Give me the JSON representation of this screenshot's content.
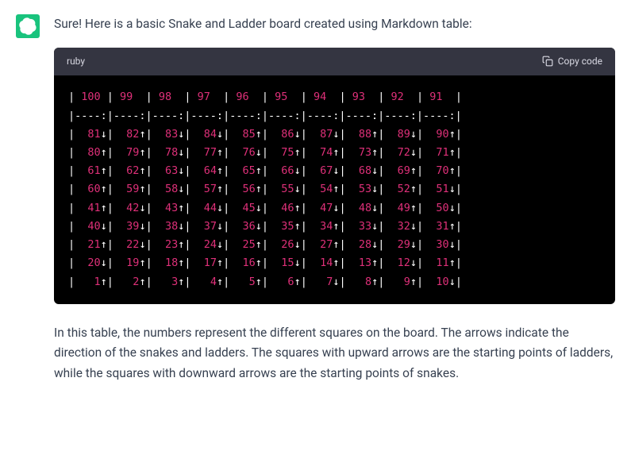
{
  "intro": "Sure! Here is a basic Snake and Ladder board created using Markdown table:",
  "code": {
    "language": "ruby",
    "copy_label": "Copy code",
    "rows": [
      [
        {
          "t": "| ",
          "c": "w"
        },
        {
          "t": "100",
          "c": "r"
        },
        {
          "t": " | ",
          "c": "w"
        },
        {
          "t": "99",
          "c": "r"
        },
        {
          "t": "  | ",
          "c": "w"
        },
        {
          "t": "98",
          "c": "r"
        },
        {
          "t": "  | ",
          "c": "w"
        },
        {
          "t": "97",
          "c": "r"
        },
        {
          "t": "  | ",
          "c": "w"
        },
        {
          "t": "96",
          "c": "r"
        },
        {
          "t": "  | ",
          "c": "w"
        },
        {
          "t": "95",
          "c": "r"
        },
        {
          "t": "  | ",
          "c": "w"
        },
        {
          "t": "94",
          "c": "r"
        },
        {
          "t": "  | ",
          "c": "w"
        },
        {
          "t": "93",
          "c": "r"
        },
        {
          "t": "  | ",
          "c": "w"
        },
        {
          "t": "92",
          "c": "r"
        },
        {
          "t": "  | ",
          "c": "w"
        },
        {
          "t": "91",
          "c": "r"
        },
        {
          "t": "  |",
          "c": "w"
        }
      ],
      [
        {
          "t": "|----:|----:|----:|----:|----:|----:|----:|----:|----:|----:|",
          "c": "w"
        }
      ],
      [
        {
          "t": "|  ",
          "c": "w"
        },
        {
          "t": "81",
          "c": "r"
        },
        {
          "t": "↓|  ",
          "c": "w"
        },
        {
          "t": "82",
          "c": "r"
        },
        {
          "t": "↑|  ",
          "c": "w"
        },
        {
          "t": "83",
          "c": "r"
        },
        {
          "t": "↓|  ",
          "c": "w"
        },
        {
          "t": "84",
          "c": "r"
        },
        {
          "t": "↓|  ",
          "c": "w"
        },
        {
          "t": "85",
          "c": "r"
        },
        {
          "t": "↑|  ",
          "c": "w"
        },
        {
          "t": "86",
          "c": "r"
        },
        {
          "t": "↓|  ",
          "c": "w"
        },
        {
          "t": "87",
          "c": "r"
        },
        {
          "t": "↓|  ",
          "c": "w"
        },
        {
          "t": "88",
          "c": "r"
        },
        {
          "t": "↑|  ",
          "c": "w"
        },
        {
          "t": "89",
          "c": "r"
        },
        {
          "t": "↓|  ",
          "c": "w"
        },
        {
          "t": "90",
          "c": "r"
        },
        {
          "t": "↑|",
          "c": "w"
        }
      ],
      [
        {
          "t": "|  ",
          "c": "w"
        },
        {
          "t": "80",
          "c": "r"
        },
        {
          "t": "↑|  ",
          "c": "w"
        },
        {
          "t": "79",
          "c": "r"
        },
        {
          "t": "↑|  ",
          "c": "w"
        },
        {
          "t": "78",
          "c": "r"
        },
        {
          "t": "↓|  ",
          "c": "w"
        },
        {
          "t": "77",
          "c": "r"
        },
        {
          "t": "↑|  ",
          "c": "w"
        },
        {
          "t": "76",
          "c": "r"
        },
        {
          "t": "↓|  ",
          "c": "w"
        },
        {
          "t": "75",
          "c": "r"
        },
        {
          "t": "↑|  ",
          "c": "w"
        },
        {
          "t": "74",
          "c": "r"
        },
        {
          "t": "↑|  ",
          "c": "w"
        },
        {
          "t": "73",
          "c": "r"
        },
        {
          "t": "↑|  ",
          "c": "w"
        },
        {
          "t": "72",
          "c": "r"
        },
        {
          "t": "↓|  ",
          "c": "w"
        },
        {
          "t": "71",
          "c": "r"
        },
        {
          "t": "↑|",
          "c": "w"
        }
      ],
      [
        {
          "t": "|  ",
          "c": "w"
        },
        {
          "t": "61",
          "c": "r"
        },
        {
          "t": "↑|  ",
          "c": "w"
        },
        {
          "t": "62",
          "c": "r"
        },
        {
          "t": "↑|  ",
          "c": "w"
        },
        {
          "t": "63",
          "c": "r"
        },
        {
          "t": "↓|  ",
          "c": "w"
        },
        {
          "t": "64",
          "c": "r"
        },
        {
          "t": "↑|  ",
          "c": "w"
        },
        {
          "t": "65",
          "c": "r"
        },
        {
          "t": "↑|  ",
          "c": "w"
        },
        {
          "t": "66",
          "c": "r"
        },
        {
          "t": "↓|  ",
          "c": "w"
        },
        {
          "t": "67",
          "c": "r"
        },
        {
          "t": "↓|  ",
          "c": "w"
        },
        {
          "t": "68",
          "c": "r"
        },
        {
          "t": "↓|  ",
          "c": "w"
        },
        {
          "t": "69",
          "c": "r"
        },
        {
          "t": "↑|  ",
          "c": "w"
        },
        {
          "t": "70",
          "c": "r"
        },
        {
          "t": "↑|",
          "c": "w"
        }
      ],
      [
        {
          "t": "|  ",
          "c": "w"
        },
        {
          "t": "60",
          "c": "r"
        },
        {
          "t": "↑|  ",
          "c": "w"
        },
        {
          "t": "59",
          "c": "r"
        },
        {
          "t": "↑|  ",
          "c": "w"
        },
        {
          "t": "58",
          "c": "r"
        },
        {
          "t": "↓|  ",
          "c": "w"
        },
        {
          "t": "57",
          "c": "r"
        },
        {
          "t": "↑|  ",
          "c": "w"
        },
        {
          "t": "56",
          "c": "r"
        },
        {
          "t": "↑|  ",
          "c": "w"
        },
        {
          "t": "55",
          "c": "r"
        },
        {
          "t": "↓|  ",
          "c": "w"
        },
        {
          "t": "54",
          "c": "r"
        },
        {
          "t": "↑|  ",
          "c": "w"
        },
        {
          "t": "53",
          "c": "r"
        },
        {
          "t": "↓|  ",
          "c": "w"
        },
        {
          "t": "52",
          "c": "r"
        },
        {
          "t": "↑|  ",
          "c": "w"
        },
        {
          "t": "51",
          "c": "r"
        },
        {
          "t": "↓|",
          "c": "w"
        }
      ],
      [
        {
          "t": "|  ",
          "c": "w"
        },
        {
          "t": "41",
          "c": "r"
        },
        {
          "t": "↑|  ",
          "c": "w"
        },
        {
          "t": "42",
          "c": "r"
        },
        {
          "t": "↓|  ",
          "c": "w"
        },
        {
          "t": "43",
          "c": "r"
        },
        {
          "t": "↑|  ",
          "c": "w"
        },
        {
          "t": "44",
          "c": "r"
        },
        {
          "t": "↓|  ",
          "c": "w"
        },
        {
          "t": "45",
          "c": "r"
        },
        {
          "t": "↓|  ",
          "c": "w"
        },
        {
          "t": "46",
          "c": "r"
        },
        {
          "t": "↑|  ",
          "c": "w"
        },
        {
          "t": "47",
          "c": "r"
        },
        {
          "t": "↓|  ",
          "c": "w"
        },
        {
          "t": "48",
          "c": "r"
        },
        {
          "t": "↓|  ",
          "c": "w"
        },
        {
          "t": "49",
          "c": "r"
        },
        {
          "t": "↑|  ",
          "c": "w"
        },
        {
          "t": "50",
          "c": "r"
        },
        {
          "t": "↓|",
          "c": "w"
        }
      ],
      [
        {
          "t": "|  ",
          "c": "w"
        },
        {
          "t": "40",
          "c": "r"
        },
        {
          "t": "↓|  ",
          "c": "w"
        },
        {
          "t": "39",
          "c": "r"
        },
        {
          "t": "↓|  ",
          "c": "w"
        },
        {
          "t": "38",
          "c": "r"
        },
        {
          "t": "↓|  ",
          "c": "w"
        },
        {
          "t": "37",
          "c": "r"
        },
        {
          "t": "↓|  ",
          "c": "w"
        },
        {
          "t": "36",
          "c": "r"
        },
        {
          "t": "↓|  ",
          "c": "w"
        },
        {
          "t": "35",
          "c": "r"
        },
        {
          "t": "↑|  ",
          "c": "w"
        },
        {
          "t": "34",
          "c": "r"
        },
        {
          "t": "↑|  ",
          "c": "w"
        },
        {
          "t": "33",
          "c": "r"
        },
        {
          "t": "↓|  ",
          "c": "w"
        },
        {
          "t": "32",
          "c": "r"
        },
        {
          "t": "↓|  ",
          "c": "w"
        },
        {
          "t": "31",
          "c": "r"
        },
        {
          "t": "↑|",
          "c": "w"
        }
      ],
      [
        {
          "t": "|  ",
          "c": "w"
        },
        {
          "t": "21",
          "c": "r"
        },
        {
          "t": "↑|  ",
          "c": "w"
        },
        {
          "t": "22",
          "c": "r"
        },
        {
          "t": "↓|  ",
          "c": "w"
        },
        {
          "t": "23",
          "c": "r"
        },
        {
          "t": "↑|  ",
          "c": "w"
        },
        {
          "t": "24",
          "c": "r"
        },
        {
          "t": "↓|  ",
          "c": "w"
        },
        {
          "t": "25",
          "c": "r"
        },
        {
          "t": "↑|  ",
          "c": "w"
        },
        {
          "t": "26",
          "c": "r"
        },
        {
          "t": "↓|  ",
          "c": "w"
        },
        {
          "t": "27",
          "c": "r"
        },
        {
          "t": "↑|  ",
          "c": "w"
        },
        {
          "t": "28",
          "c": "r"
        },
        {
          "t": "↓|  ",
          "c": "w"
        },
        {
          "t": "29",
          "c": "r"
        },
        {
          "t": "↓|  ",
          "c": "w"
        },
        {
          "t": "30",
          "c": "r"
        },
        {
          "t": "↓|",
          "c": "w"
        }
      ],
      [
        {
          "t": "|  ",
          "c": "w"
        },
        {
          "t": "20",
          "c": "r"
        },
        {
          "t": "↓|  ",
          "c": "w"
        },
        {
          "t": "19",
          "c": "r"
        },
        {
          "t": "↑|  ",
          "c": "w"
        },
        {
          "t": "18",
          "c": "r"
        },
        {
          "t": "↑|  ",
          "c": "w"
        },
        {
          "t": "17",
          "c": "r"
        },
        {
          "t": "↑|  ",
          "c": "w"
        },
        {
          "t": "16",
          "c": "r"
        },
        {
          "t": "↑|  ",
          "c": "w"
        },
        {
          "t": "15",
          "c": "r"
        },
        {
          "t": "↓|  ",
          "c": "w"
        },
        {
          "t": "14",
          "c": "r"
        },
        {
          "t": "↑|  ",
          "c": "w"
        },
        {
          "t": "13",
          "c": "r"
        },
        {
          "t": "↑|  ",
          "c": "w"
        },
        {
          "t": "12",
          "c": "r"
        },
        {
          "t": "↓|  ",
          "c": "w"
        },
        {
          "t": "11",
          "c": "r"
        },
        {
          "t": "↑|",
          "c": "w"
        }
      ],
      [
        {
          "t": "|   ",
          "c": "w"
        },
        {
          "t": "1",
          "c": "r"
        },
        {
          "t": "↑|   ",
          "c": "w"
        },
        {
          "t": "2",
          "c": "r"
        },
        {
          "t": "↑|   ",
          "c": "w"
        },
        {
          "t": "3",
          "c": "r"
        },
        {
          "t": "↑|   ",
          "c": "w"
        },
        {
          "t": "4",
          "c": "r"
        },
        {
          "t": "↑|   ",
          "c": "w"
        },
        {
          "t": "5",
          "c": "r"
        },
        {
          "t": "↑|   ",
          "c": "w"
        },
        {
          "t": "6",
          "c": "r"
        },
        {
          "t": "↑|   ",
          "c": "w"
        },
        {
          "t": "7",
          "c": "r"
        },
        {
          "t": "↓|   ",
          "c": "w"
        },
        {
          "t": "8",
          "c": "r"
        },
        {
          "t": "↑|   ",
          "c": "w"
        },
        {
          "t": "9",
          "c": "r"
        },
        {
          "t": "↑|  ",
          "c": "w"
        },
        {
          "t": "10",
          "c": "r"
        },
        {
          "t": "↓|",
          "c": "w"
        }
      ]
    ]
  },
  "outro": "In this table, the numbers represent the different squares on the board. The arrows indicate the direction of the snakes and ladders. The squares with upward arrows are the starting points of ladders, while the squares with downward arrows are the starting points of snakes."
}
